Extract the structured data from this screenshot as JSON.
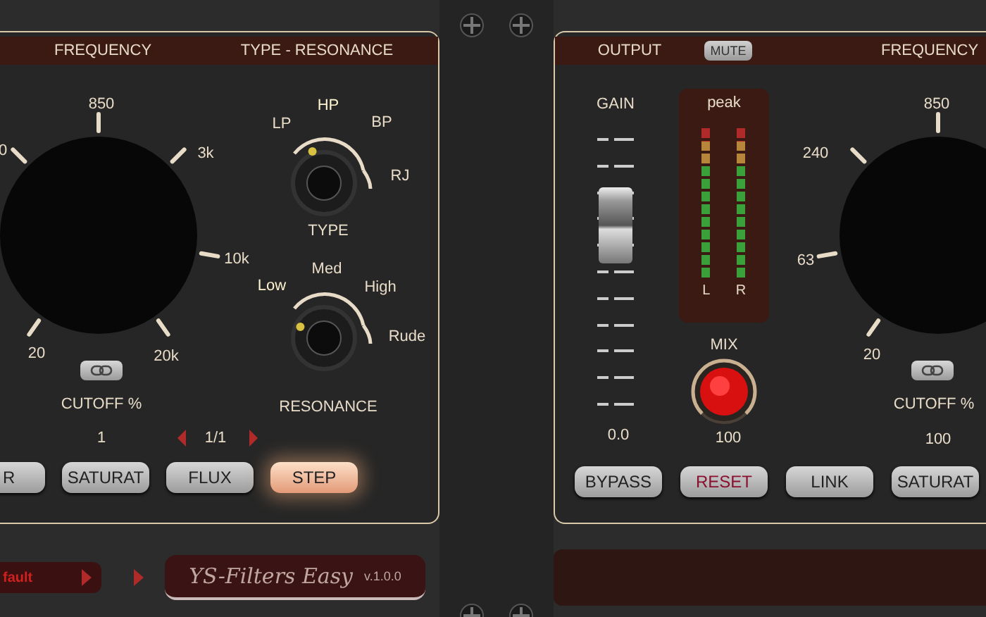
{
  "left_panel": {
    "headers": [
      "FREQUENCY",
      "TYPE - RESONANCE"
    ],
    "cutoff_knob": {
      "scale": [
        "0",
        "850",
        "3k",
        "10k",
        "20k",
        "20"
      ],
      "label": "CUTOFF %",
      "value": "1"
    },
    "type_switch": {
      "positions": [
        {
          "label": "LP",
          "selected": false
        },
        {
          "label": "HP",
          "selected": true
        },
        {
          "label": "BP",
          "selected": false
        },
        {
          "label": "RJ",
          "selected": false
        }
      ],
      "label": "TYPE"
    },
    "resonance_switch": {
      "positions": [
        {
          "label": "Low",
          "selected": true
        },
        {
          "label": "Med",
          "selected": false
        },
        {
          "label": "High",
          "selected": false
        },
        {
          "label": "Rude",
          "selected": false
        }
      ],
      "label": "RESONANCE"
    },
    "step_counter": "1/1",
    "buttons": [
      {
        "label": "R",
        "on": false
      },
      {
        "label": "SATURAT",
        "on": false
      },
      {
        "label": "FLUX",
        "on": false
      },
      {
        "label": "STEP",
        "on": true
      }
    ]
  },
  "right_panel": {
    "header": "OUTPUT",
    "mute_button": "MUTE",
    "header_2": "FREQUENCY",
    "gain": {
      "label": "GAIN",
      "level": 0.67,
      "value": "0.0"
    },
    "meter": {
      "title": "peak",
      "channels": [
        {
          "label": "L",
          "level": 1
        },
        {
          "label": "R",
          "level": 1
        }
      ]
    },
    "mix": {
      "label": "MIX",
      "level": 1,
      "value": "100"
    },
    "cutoff_knob": {
      "scale": [
        "240",
        "850",
        "63",
        "20"
      ],
      "label": "CUTOFF %",
      "value": "100"
    },
    "buttons": [
      {
        "label": "BYPASS",
        "kind": "normal"
      },
      {
        "label": "RESET",
        "kind": "warning"
      },
      {
        "label": "LINK",
        "kind": "normal"
      },
      {
        "label": "SATURAT",
        "kind": "normal"
      }
    ]
  },
  "footer": {
    "preset": "fault",
    "title": "YS-Filters Easy",
    "version": "v.1.0.0"
  }
}
